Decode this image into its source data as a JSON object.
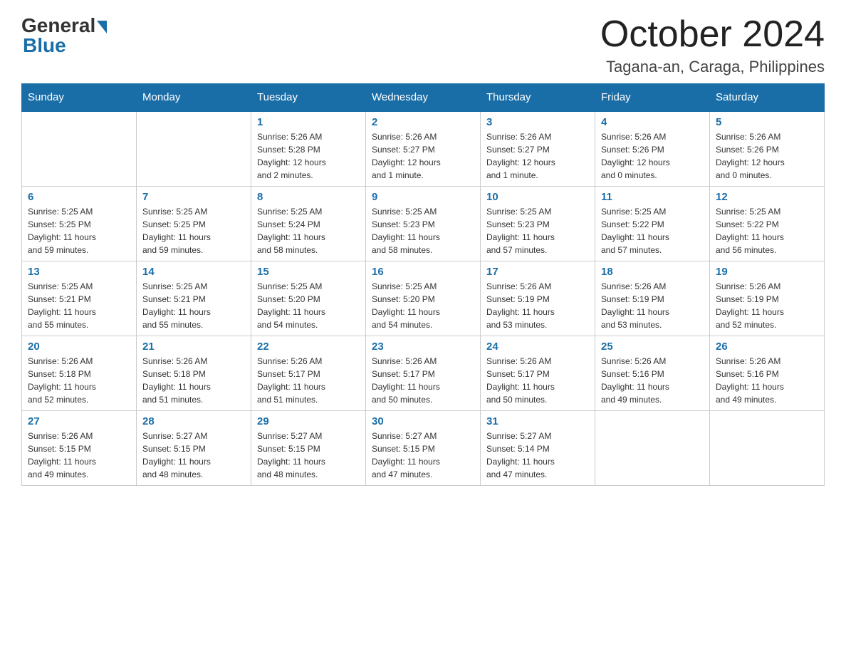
{
  "logo": {
    "general": "General",
    "blue": "Blue"
  },
  "header": {
    "month": "October 2024",
    "location": "Tagana-an, Caraga, Philippines"
  },
  "weekdays": [
    "Sunday",
    "Monday",
    "Tuesday",
    "Wednesday",
    "Thursday",
    "Friday",
    "Saturday"
  ],
  "weeks": [
    [
      {
        "day": "",
        "info": ""
      },
      {
        "day": "",
        "info": ""
      },
      {
        "day": "1",
        "info": "Sunrise: 5:26 AM\nSunset: 5:28 PM\nDaylight: 12 hours\nand 2 minutes."
      },
      {
        "day": "2",
        "info": "Sunrise: 5:26 AM\nSunset: 5:27 PM\nDaylight: 12 hours\nand 1 minute."
      },
      {
        "day": "3",
        "info": "Sunrise: 5:26 AM\nSunset: 5:27 PM\nDaylight: 12 hours\nand 1 minute."
      },
      {
        "day": "4",
        "info": "Sunrise: 5:26 AM\nSunset: 5:26 PM\nDaylight: 12 hours\nand 0 minutes."
      },
      {
        "day": "5",
        "info": "Sunrise: 5:26 AM\nSunset: 5:26 PM\nDaylight: 12 hours\nand 0 minutes."
      }
    ],
    [
      {
        "day": "6",
        "info": "Sunrise: 5:25 AM\nSunset: 5:25 PM\nDaylight: 11 hours\nand 59 minutes."
      },
      {
        "day": "7",
        "info": "Sunrise: 5:25 AM\nSunset: 5:25 PM\nDaylight: 11 hours\nand 59 minutes."
      },
      {
        "day": "8",
        "info": "Sunrise: 5:25 AM\nSunset: 5:24 PM\nDaylight: 11 hours\nand 58 minutes."
      },
      {
        "day": "9",
        "info": "Sunrise: 5:25 AM\nSunset: 5:23 PM\nDaylight: 11 hours\nand 58 minutes."
      },
      {
        "day": "10",
        "info": "Sunrise: 5:25 AM\nSunset: 5:23 PM\nDaylight: 11 hours\nand 57 minutes."
      },
      {
        "day": "11",
        "info": "Sunrise: 5:25 AM\nSunset: 5:22 PM\nDaylight: 11 hours\nand 57 minutes."
      },
      {
        "day": "12",
        "info": "Sunrise: 5:25 AM\nSunset: 5:22 PM\nDaylight: 11 hours\nand 56 minutes."
      }
    ],
    [
      {
        "day": "13",
        "info": "Sunrise: 5:25 AM\nSunset: 5:21 PM\nDaylight: 11 hours\nand 55 minutes."
      },
      {
        "day": "14",
        "info": "Sunrise: 5:25 AM\nSunset: 5:21 PM\nDaylight: 11 hours\nand 55 minutes."
      },
      {
        "day": "15",
        "info": "Sunrise: 5:25 AM\nSunset: 5:20 PM\nDaylight: 11 hours\nand 54 minutes."
      },
      {
        "day": "16",
        "info": "Sunrise: 5:25 AM\nSunset: 5:20 PM\nDaylight: 11 hours\nand 54 minutes."
      },
      {
        "day": "17",
        "info": "Sunrise: 5:26 AM\nSunset: 5:19 PM\nDaylight: 11 hours\nand 53 minutes."
      },
      {
        "day": "18",
        "info": "Sunrise: 5:26 AM\nSunset: 5:19 PM\nDaylight: 11 hours\nand 53 minutes."
      },
      {
        "day": "19",
        "info": "Sunrise: 5:26 AM\nSunset: 5:19 PM\nDaylight: 11 hours\nand 52 minutes."
      }
    ],
    [
      {
        "day": "20",
        "info": "Sunrise: 5:26 AM\nSunset: 5:18 PM\nDaylight: 11 hours\nand 52 minutes."
      },
      {
        "day": "21",
        "info": "Sunrise: 5:26 AM\nSunset: 5:18 PM\nDaylight: 11 hours\nand 51 minutes."
      },
      {
        "day": "22",
        "info": "Sunrise: 5:26 AM\nSunset: 5:17 PM\nDaylight: 11 hours\nand 51 minutes."
      },
      {
        "day": "23",
        "info": "Sunrise: 5:26 AM\nSunset: 5:17 PM\nDaylight: 11 hours\nand 50 minutes."
      },
      {
        "day": "24",
        "info": "Sunrise: 5:26 AM\nSunset: 5:17 PM\nDaylight: 11 hours\nand 50 minutes."
      },
      {
        "day": "25",
        "info": "Sunrise: 5:26 AM\nSunset: 5:16 PM\nDaylight: 11 hours\nand 49 minutes."
      },
      {
        "day": "26",
        "info": "Sunrise: 5:26 AM\nSunset: 5:16 PM\nDaylight: 11 hours\nand 49 minutes."
      }
    ],
    [
      {
        "day": "27",
        "info": "Sunrise: 5:26 AM\nSunset: 5:15 PM\nDaylight: 11 hours\nand 49 minutes."
      },
      {
        "day": "28",
        "info": "Sunrise: 5:27 AM\nSunset: 5:15 PM\nDaylight: 11 hours\nand 48 minutes."
      },
      {
        "day": "29",
        "info": "Sunrise: 5:27 AM\nSunset: 5:15 PM\nDaylight: 11 hours\nand 48 minutes."
      },
      {
        "day": "30",
        "info": "Sunrise: 5:27 AM\nSunset: 5:15 PM\nDaylight: 11 hours\nand 47 minutes."
      },
      {
        "day": "31",
        "info": "Sunrise: 5:27 AM\nSunset: 5:14 PM\nDaylight: 11 hours\nand 47 minutes."
      },
      {
        "day": "",
        "info": ""
      },
      {
        "day": "",
        "info": ""
      }
    ]
  ]
}
